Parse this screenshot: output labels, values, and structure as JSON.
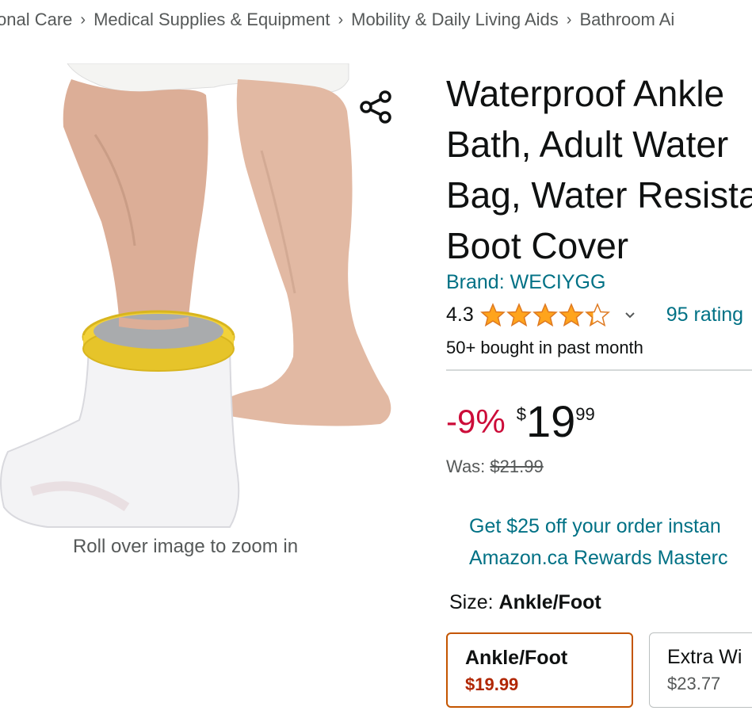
{
  "breadcrumb": [
    "onal Care",
    "Medical Supplies & Equipment",
    "Mobility & Daily Living Aids",
    "Bathroom Ai"
  ],
  "breadcrumb_separator": "›",
  "image": {
    "zoom_hint": "Roll over image to zoom in"
  },
  "product": {
    "title_lines": [
      "Waterproof Ankle",
      "Bath, Adult Water",
      "Bag, Water Resista",
      "Boot Cover"
    ],
    "brand": "Brand: WECIYGG",
    "rating_value": "4.3",
    "rating_stars": 4.3,
    "ratings_count": "95 rating",
    "bought": "50+ bought in past month",
    "discount": "-9%",
    "price_currency": "$",
    "price_whole": "19",
    "price_fraction": "99",
    "was_label": "Was: ",
    "was_price": "$21.99",
    "promo_line1": "Get $25 off your order instan",
    "promo_line2": "Amazon.ca Rewards Masterc"
  },
  "size": {
    "label": "Size: ",
    "selected_value": "Ankle/Foot",
    "options": [
      {
        "name": "Ankle/Foot",
        "price": "$19.99",
        "selected": true
      },
      {
        "name": "Extra Wi",
        "price": "$23.77",
        "selected": false
      }
    ]
  },
  "colors": {
    "link": "#007185",
    "discount": "#cc0c39",
    "star": "#ffa41c",
    "selected_border": "#c45500"
  }
}
